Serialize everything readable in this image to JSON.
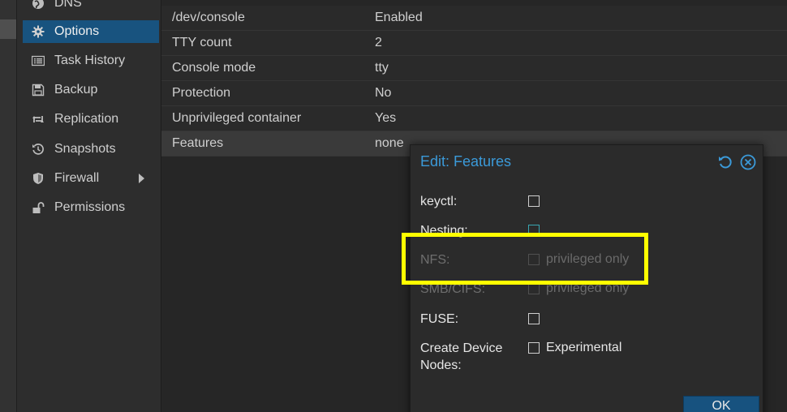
{
  "sidebar": {
    "items": [
      {
        "label": "DNS",
        "icon": "globe-icon"
      },
      {
        "label": "Options",
        "icon": "gear-icon",
        "active": true
      },
      {
        "label": "Task History",
        "icon": "list-icon"
      },
      {
        "label": "Backup",
        "icon": "floppy-icon"
      },
      {
        "label": "Replication",
        "icon": "retweet-icon"
      },
      {
        "label": "Snapshots",
        "icon": "history-icon"
      },
      {
        "label": "Firewall",
        "icon": "shield-icon",
        "has_submenu": true
      },
      {
        "label": "Permissions",
        "icon": "unlock-icon"
      }
    ]
  },
  "options_table": {
    "rows": [
      {
        "key": "/dev/console",
        "value": "Enabled"
      },
      {
        "key": "TTY count",
        "value": "2"
      },
      {
        "key": "Console mode",
        "value": "tty"
      },
      {
        "key": "Protection",
        "value": "No"
      },
      {
        "key": "Unprivileged container",
        "value": "Yes"
      },
      {
        "key": "Features",
        "value": "none",
        "selected": true
      }
    ]
  },
  "dialog": {
    "title": "Edit: Features",
    "fields": [
      {
        "label": "keyctl:",
        "checkbox_text": "",
        "disabled": false
      },
      {
        "label": "Nesting:",
        "checkbox_text": "",
        "disabled": false
      },
      {
        "label": "NFS:",
        "checkbox_text": "privileged only",
        "disabled": true
      },
      {
        "label": "SMB/CIFS:",
        "checkbox_text": "privileged only",
        "disabled": true
      },
      {
        "label": "FUSE:",
        "checkbox_text": "",
        "disabled": false
      },
      {
        "label": "Create Device Nodes:",
        "checkbox_text": "Experimental",
        "disabled": false
      }
    ],
    "ok_label": "OK"
  },
  "colors": {
    "accent": "#3b9ad9",
    "active_nav": "#18537f",
    "highlight": "#ffff00"
  }
}
